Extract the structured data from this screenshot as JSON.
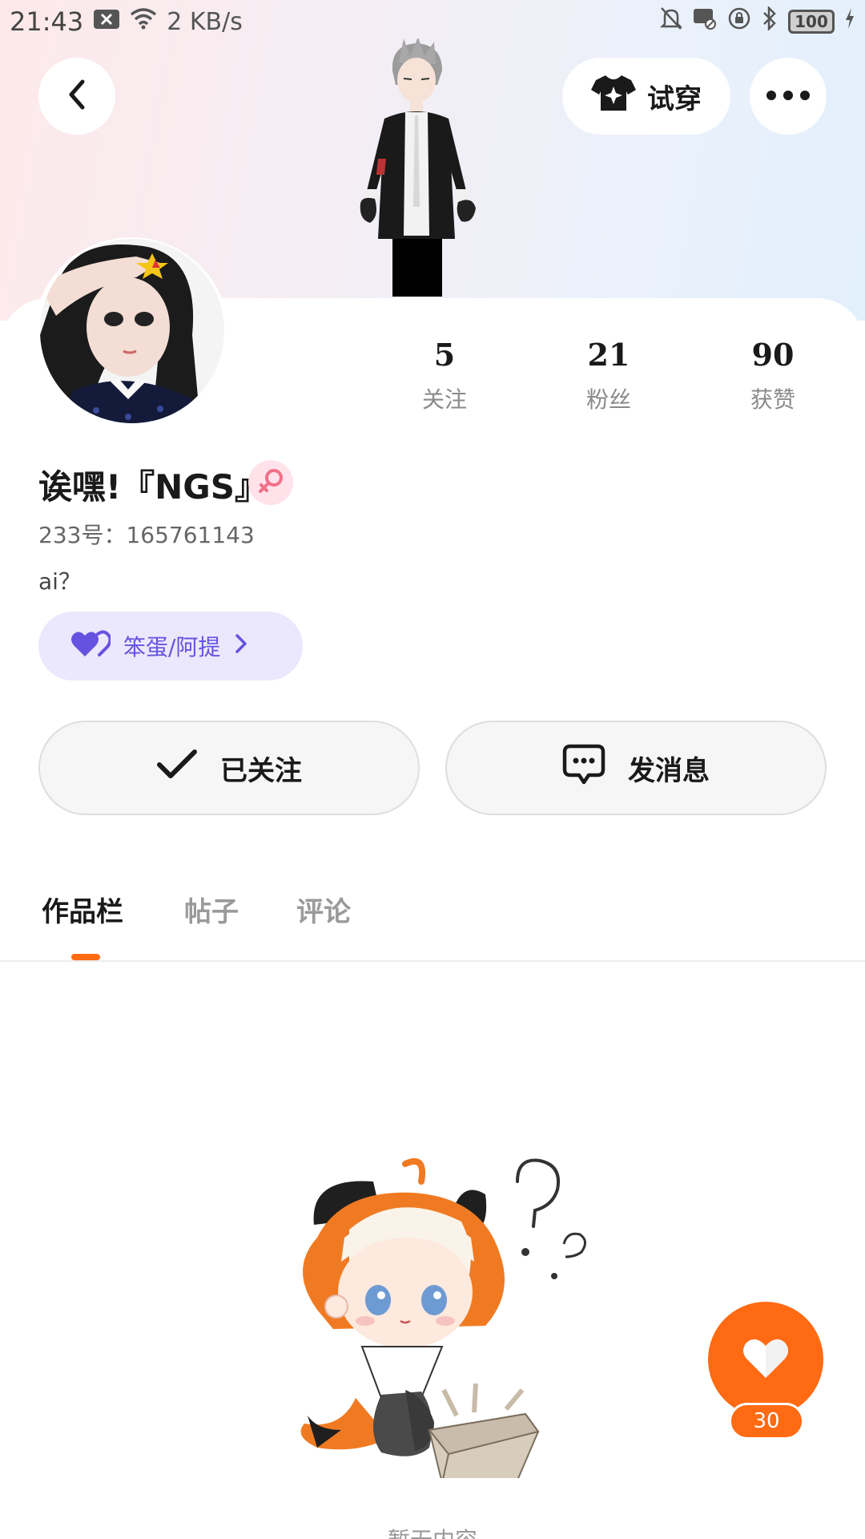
{
  "status_bar": {
    "time": "21:43",
    "net_speed": "2 KB/s",
    "battery": "100",
    "icons": [
      "notification-x-icon",
      "wifi-icon",
      "mute-bell-icon",
      "message-blocked-icon",
      "rotation-lock-icon",
      "bluetooth-icon",
      "battery-icon",
      "charging-icon"
    ]
  },
  "header": {
    "back_icon": "chevron-left-icon",
    "tryon_label": "试穿",
    "tryon_icon": "shirt-sparkle-icon",
    "more_icon": "more-dots-icon"
  },
  "profile": {
    "username": "诶嘿!『NGS』",
    "gender_icon": "female-icon",
    "uid_text": "233号：165761143",
    "bio": "ai？",
    "tag_label": "笨蛋/阿提",
    "tag_icon": "double-heart-icon",
    "stats": [
      {
        "value": "5",
        "label": "关注"
      },
      {
        "value": "21",
        "label": "粉丝"
      },
      {
        "value": "90",
        "label": "获赞"
      }
    ]
  },
  "actions": {
    "follow_label": "已关注",
    "message_label": "发消息"
  },
  "tabs": [
    {
      "label": "作品栏",
      "active": true
    },
    {
      "label": "帖子",
      "active": false
    },
    {
      "label": "评论",
      "active": false
    }
  ],
  "empty_state": {
    "text": "暂无内容"
  },
  "like_fab": {
    "count": "30"
  },
  "colors": {
    "accent": "#ff6a13",
    "tag_bg": "#ebe8fd",
    "tag_text": "#6652e0",
    "gender_bg": "#ffe2ea",
    "gender_icon": "#f0708a"
  }
}
